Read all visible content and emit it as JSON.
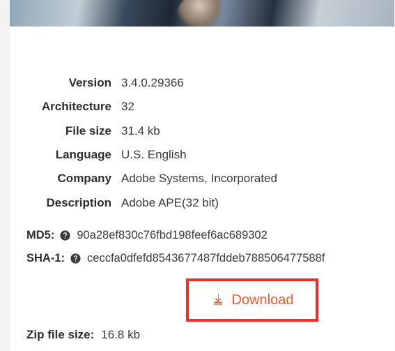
{
  "info": {
    "version": {
      "label": "Version",
      "value": "3.4.0.29366"
    },
    "architecture": {
      "label": "Architecture",
      "value": "32"
    },
    "filesize": {
      "label": "File size",
      "value": "31.4 kb"
    },
    "language": {
      "label": "Language",
      "value": "U.S. English"
    },
    "company": {
      "label": "Company",
      "value": "Adobe Systems, Incorporated"
    },
    "description": {
      "label": "Description",
      "value": "Adobe APE(32 bit)"
    }
  },
  "hashes": {
    "md5": {
      "label": "MD5:",
      "value": "90a28ef830c76fbd198feef6ac689302"
    },
    "sha1": {
      "label": "SHA-1:",
      "value": "ceccfa0dfefd8543677487fddeb788506477588f"
    }
  },
  "download": {
    "label": "Download"
  },
  "zip": {
    "label": "Zip file size:",
    "value": "16.8 kb"
  }
}
